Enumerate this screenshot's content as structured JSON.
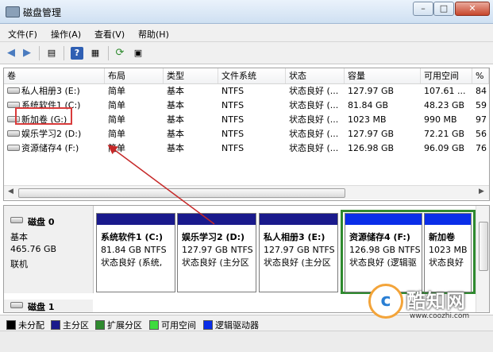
{
  "window": {
    "title": "磁盘管理",
    "min_label": "–",
    "max_label": "□",
    "close_label": "✕"
  },
  "menu": [
    "文件(F)",
    "操作(A)",
    "查看(V)",
    "帮助(H)"
  ],
  "toolbar_icons": [
    "back-icon",
    "forward-icon",
    "list-view-icon",
    "help-icon",
    "properties-icon",
    "refresh-icon",
    "rescan-icon"
  ],
  "volumes": {
    "columns": [
      "卷",
      "布局",
      "类型",
      "文件系统",
      "状态",
      "容量",
      "可用空间",
      "%"
    ],
    "rows": [
      [
        "私人相册3 (E:)",
        "简单",
        "基本",
        "NTFS",
        "状态良好 (...",
        "127.97 GB",
        "107.61 ...",
        "84"
      ],
      [
        "系统软件1 (C:)",
        "简单",
        "基本",
        "NTFS",
        "状态良好 (...",
        "81.84 GB",
        "48.23 GB",
        "59"
      ],
      [
        "新加卷 (G:)",
        "简单",
        "基本",
        "NTFS",
        "状态良好 (...",
        "1023 MB",
        "990 MB",
        "97"
      ],
      [
        "娱乐学习2 (D:)",
        "简单",
        "基本",
        "NTFS",
        "状态良好 (...",
        "127.97 GB",
        "72.21 GB",
        "56"
      ],
      [
        "资源储存4 (F:)",
        "简单",
        "基本",
        "NTFS",
        "状态良好 (...",
        "126.98 GB",
        "96.09 GB",
        "76"
      ]
    ]
  },
  "disk0": {
    "name": "磁盘 0",
    "type": "基本",
    "size": "465.76 GB",
    "status": "联机",
    "partitions": [
      {
        "name": "系统软件1  (C:)",
        "size": "81.84 GB NTFS",
        "status": "状态良好 (系统,",
        "kind": "primary"
      },
      {
        "name": "娱乐学习2  (D:)",
        "size": "127.97 GB NTFS",
        "status": "状态良好 (主分区",
        "kind": "primary"
      },
      {
        "name": "私人相册3  (E:)",
        "size": "127.97 GB NTFS",
        "status": "状态良好 (主分区",
        "kind": "primary"
      },
      {
        "name": "资源储存4  (F:)",
        "size": "126.98 GB NTFS",
        "status": "状态良好 (逻辑驱",
        "kind": "logical"
      },
      {
        "name": "新加卷",
        "size": "1023 MB",
        "status": "状态良好",
        "kind": "logical"
      }
    ]
  },
  "disk1": {
    "name": "磁盘 1"
  },
  "legend": [
    {
      "label": "未分配",
      "color": "#000000"
    },
    {
      "label": "主分区",
      "color": "#1a1a8c"
    },
    {
      "label": "扩展分区",
      "color": "#2f8a2f"
    },
    {
      "label": "可用空间",
      "color": "#3ddc3d"
    },
    {
      "label": "逻辑驱动器",
      "color": "#0a2ee8"
    }
  ],
  "watermark": {
    "brand": "酷知网",
    "url": "www.coozhi.com"
  }
}
